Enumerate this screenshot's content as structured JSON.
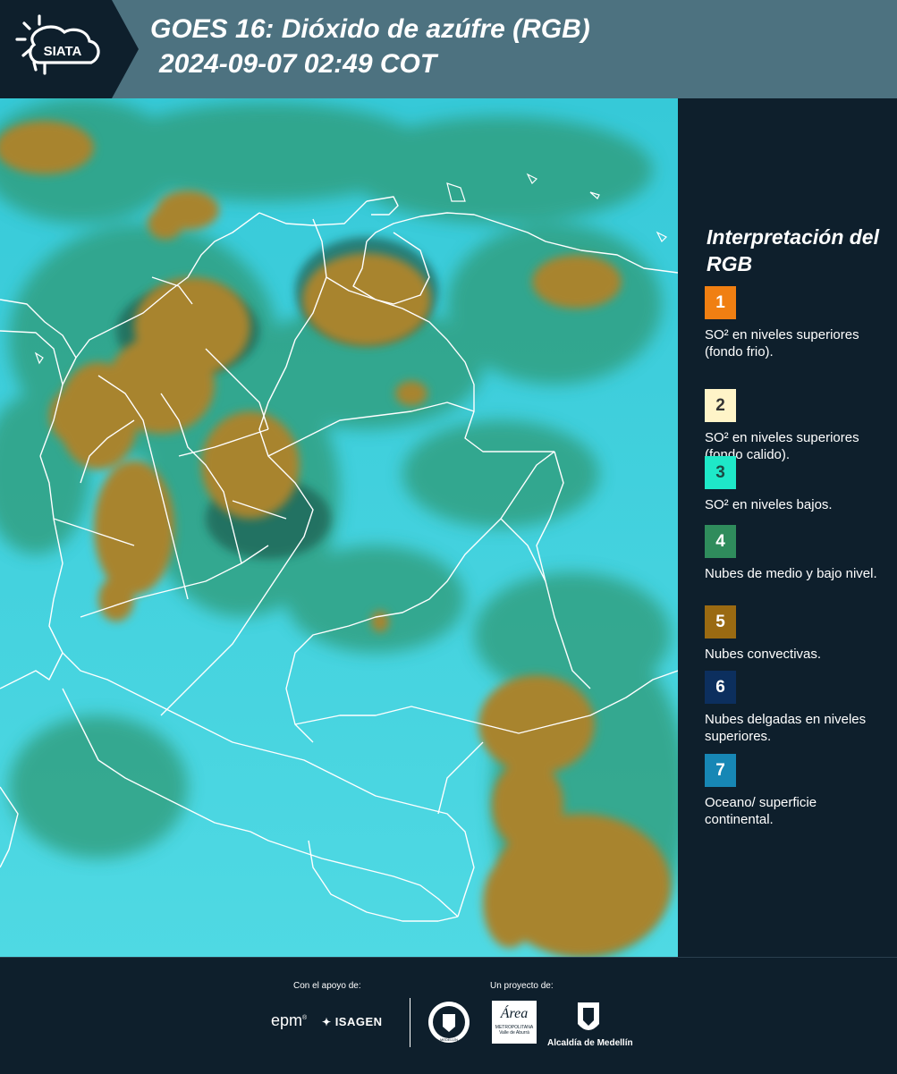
{
  "header": {
    "logo_text": "SIATA",
    "title_line1": "GOES 16: Dióxido de azúfre (RGB)",
    "title_line2": "2024-09-07 02:49 COT"
  },
  "legend": {
    "title": "Interpretación del RGB",
    "items": [
      {
        "number": "1",
        "color": "#f07f12",
        "text_color": "#ffffff",
        "label": "SO² en niveles superiores (fondo frio)."
      },
      {
        "number": "2",
        "color": "#fff4c8",
        "text_color": "#333333",
        "label": "SO² en niveles superiores (fondo calido)."
      },
      {
        "number": "3",
        "color": "#1ee8c8",
        "text_color": "#1b4b44",
        "label": "SO² en niveles bajos."
      },
      {
        "number": "4",
        "color": "#2f8c5c",
        "text_color": "#ffffff",
        "label": "Nubes de medio y bajo nivel."
      },
      {
        "number": "5",
        "color": "#9a6a12",
        "text_color": "#ffffff",
        "label": "Nubes convectivas."
      },
      {
        "number": "6",
        "color": "#0c2f5e",
        "text_color": "#ffffff",
        "label": "Nubes delgadas en niveles superiores."
      },
      {
        "number": "7",
        "color": "#1787b5",
        "text_color": "#ffffff",
        "label": "Oceano/ superficie continental."
      }
    ]
  },
  "footer": {
    "support_label": "Con el apoyo de:",
    "project_label": "Un proyecto de:",
    "sponsor_epm": "epm",
    "sponsor_isagen": "ISAGEN",
    "partner_area_line1": "Área",
    "partner_area_line2": "METROPOLITANA",
    "partner_area_line3": "Valle de Aburrá",
    "partner_alcaldia": "Alcaldía de Medellín",
    "seal_text": "MEDELLÍN"
  },
  "colors": {
    "header_bg": "#4d7280",
    "panel_bg": "#0e1f2c",
    "ocean": "#3ed6e2",
    "low_cloud": "#2e9a7c",
    "convective": "#a8842e"
  }
}
